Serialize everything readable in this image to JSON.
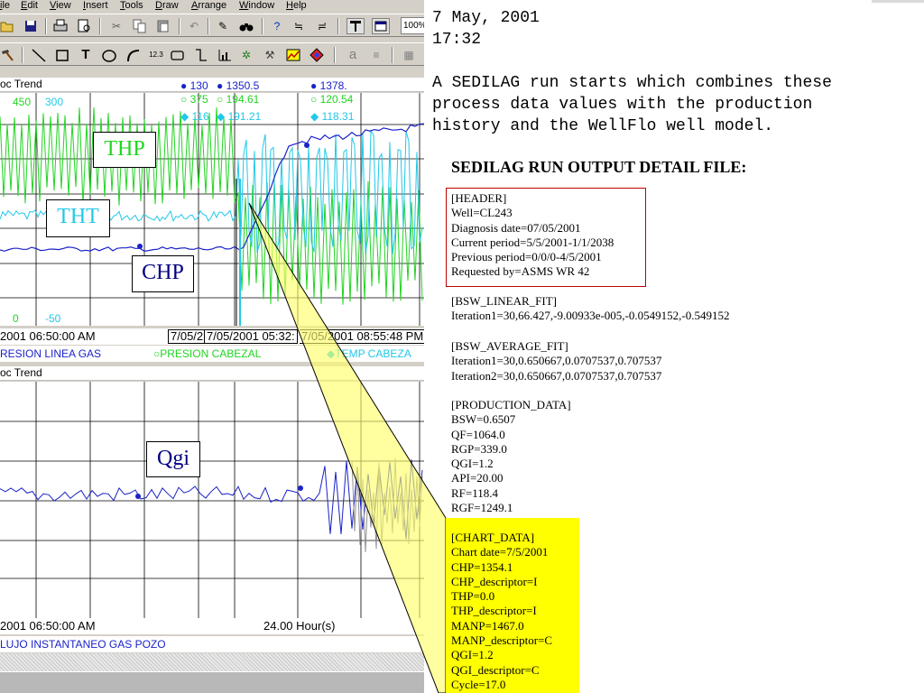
{
  "menu": [
    "ile",
    "Edit",
    "View",
    "Insert",
    "Tools",
    "Draw",
    "Arrange",
    "Window",
    "Help"
  ],
  "toolbar1": {
    "zoom": "100%"
  },
  "toolbar2": {
    "text_tool": "T",
    "number_tool": "12.3",
    "a_tool": "a"
  },
  "trend1": {
    "title": "oc Trend",
    "legend": {
      "col1_a": "450",
      "col1_b": "300",
      "s1": "130",
      "s1b": "375",
      "s1c": "116",
      "s2": "1350.5",
      "s2b": "194.61",
      "s2c": "191.21",
      "s3": "1378.",
      "s3b": "120.54",
      "s3c": "118.31"
    },
    "bottom_axis": {
      "a": "0",
      "b": "-50"
    },
    "callouts": {
      "thp": "THP",
      "tht": "THT",
      "chp": "CHP"
    },
    "time": {
      "start": "2001 06:50:00 AM",
      "box1": "7/05/2",
      "box2": "7/05/2001 05:32:",
      "box3": "7/05/2001 08:55:48 PM"
    },
    "series_legend": {
      "a": "RESION LINEA GAS",
      "b": "PRESION CABEZAL",
      "c": "TEMP CABEZA"
    },
    "colors": {
      "green": "#22d422",
      "cyan": "#22c8e8",
      "blue": "#1a22c8"
    }
  },
  "trend2": {
    "title": "oc Trend",
    "callout": "Qgi",
    "time": {
      "start": "2001 06:50:00 AM",
      "span": "24.00 Hour(s)"
    },
    "series_legend": "LUJO INSTANTANEO GAS POZO"
  },
  "note": {
    "date": "7 May, 2001",
    "time": "17:32",
    "line1": "A SEDILAG run starts which combines these",
    "line2": "process data values with the production",
    "line3": "history and the WellFlo well model."
  },
  "detail": {
    "title": "SEDILAG RUN OUTPUT DETAIL FILE:",
    "header": [
      "[HEADER]",
      "Well=CL243",
      "Diagnosis date=07/05/2001",
      "Current period=5/5/2001-1/1/2038",
      "Previous period=0/0/0-4/5/2001",
      "Requested by=ASMS WR 42"
    ],
    "bsw_linear": [
      "[BSW_LINEAR_FIT]",
      "Iteration1=30,66.427,-9.00933e-005,-0.0549152,-0.549152"
    ],
    "bsw_average": [
      "[BSW_AVERAGE_FIT]",
      "Iteration1=30,0.650667,0.0707537,0.707537",
      "Iteration2=30,0.650667,0.0707537,0.707537"
    ],
    "production": [
      "[PRODUCTION_DATA]",
      "BSW=0.6507",
      "QF=1064.0",
      "RGP=339.0",
      "QGI=1.2",
      "API=20.00",
      "RF=118.4",
      "RGF=1249.1"
    ],
    "chart": [
      "[CHART_DATA]",
      "Chart date=7/5/2001",
      "CHP=1354.1",
      "CHP_descriptor=I",
      "THP=0.0",
      "THP_descriptor=I",
      "MANP=1467.0",
      "MANP_descriptor=C",
      "QGI=1.2",
      "QGI_descriptor=C",
      "Cycle=17.0"
    ]
  }
}
